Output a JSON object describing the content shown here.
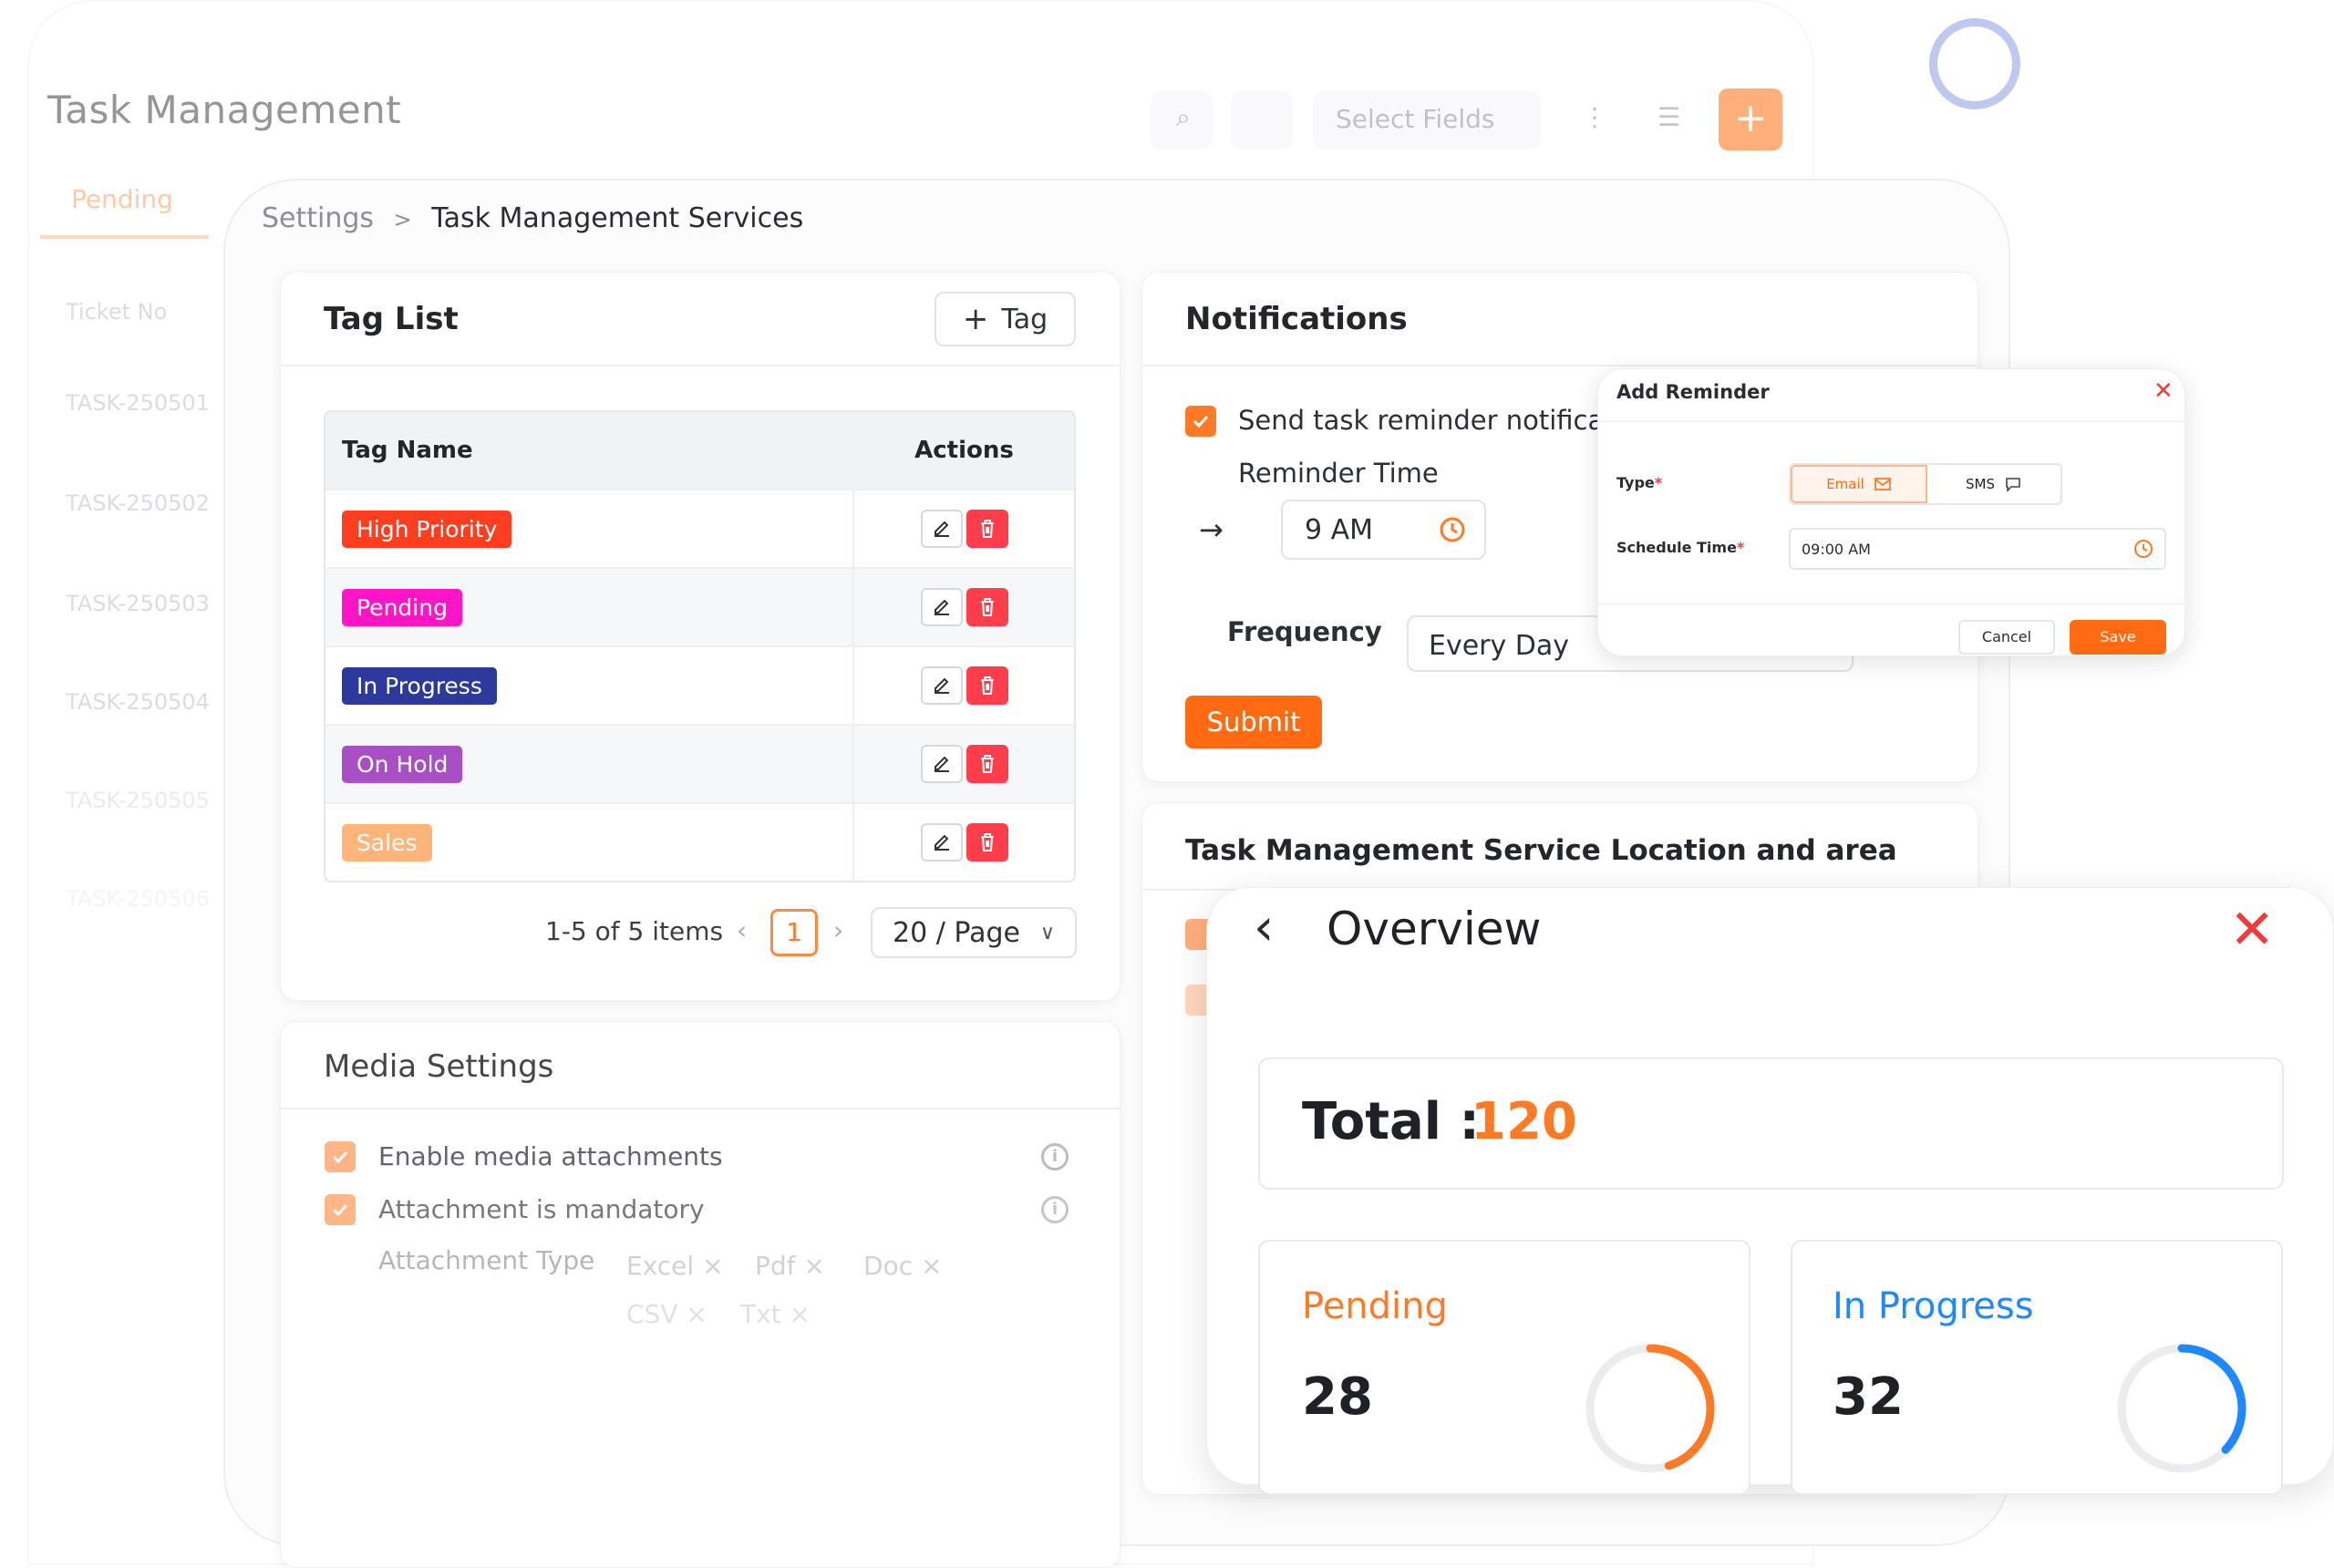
{
  "background_app": {
    "title": "Task Management",
    "active_tab": "Pending",
    "toolbar": {
      "select_fields": "Select Fields"
    },
    "table": {
      "column": "Ticket No",
      "rows": [
        "TASK-250501",
        "TASK-250502",
        "TASK-250503",
        "TASK-250504",
        "TASK-250505",
        "TASK-250506"
      ]
    }
  },
  "breadcrumb": {
    "parent": "Settings",
    "separator": ">",
    "current": "Task Management Services"
  },
  "tag_list": {
    "title": "Tag List",
    "add_button": "Tag",
    "columns": {
      "name": "Tag Name",
      "actions": "Actions"
    },
    "tags": [
      {
        "label": "High Priority",
        "color": "#ff3d1f"
      },
      {
        "label": "Pending",
        "color": "#ff14c8"
      },
      {
        "label": "In Progress",
        "color": "#2d3a9c"
      },
      {
        "label": "On Hold",
        "color": "#a84fc6"
      },
      {
        "label": "Sales",
        "color": "#ffb47a"
      }
    ],
    "pagination": {
      "summary": "1-5 of 5 items",
      "current_page": "1",
      "page_size": "20 / Page"
    }
  },
  "media_settings": {
    "title": "Media Settings",
    "enable_attachments": "Enable media attachments",
    "attachment_mandatory": "Attachment is mandatory",
    "attachment_type_label": "Attachment Type",
    "attachment_types": [
      "Excel",
      "Pdf",
      "Doc",
      "CSV",
      "Txt"
    ]
  },
  "notifications": {
    "title": "Notifications",
    "send_reminder": "Send task reminder notifica",
    "reminder_time_label": "Reminder Time",
    "reminder_time": "9 AM",
    "frequency_label": "Frequency",
    "frequency": "Every Day",
    "submit": "Submit"
  },
  "location_section": {
    "title": "Task Management Service Location and area"
  },
  "add_reminder": {
    "title": "Add Reminder",
    "type_label": "Type",
    "types": [
      "Email",
      "SMS"
    ],
    "selected_type": "Email",
    "schedule_label": "Schedule Time",
    "schedule_time": "09:00 AM",
    "cancel": "Cancel",
    "save": "Save"
  },
  "overview": {
    "title": "Overview",
    "total_label": "Total :",
    "total": "120",
    "pending": {
      "label": "Pending",
      "value": "28",
      "color": "#ff7a25",
      "progress": 0.45
    },
    "in_progress": {
      "label": "In Progress",
      "value": "32",
      "color": "#1e88ff",
      "progress": 0.37
    }
  },
  "colors": {
    "accent": "#ff6a12",
    "danger": "#ff3d4b"
  }
}
